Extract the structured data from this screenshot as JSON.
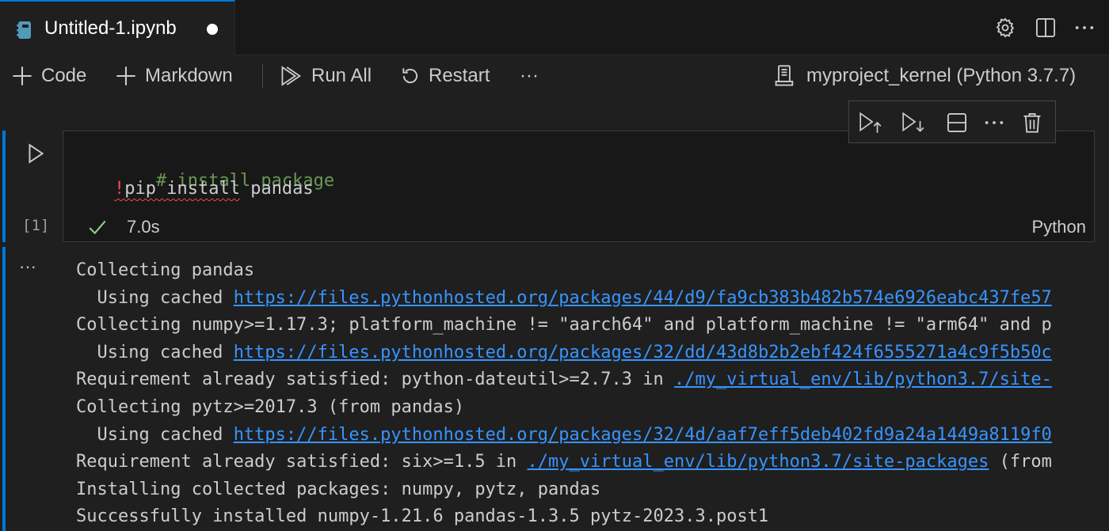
{
  "tab": {
    "title": "Untitled-1.ipynb",
    "icon": "notebook-icon",
    "modified": true
  },
  "tab_actions": [
    "gear-icon",
    "split-editor-icon",
    "more-icon"
  ],
  "toolbar": {
    "code_label": "Code",
    "markdown_label": "Markdown",
    "run_all_label": "Run All",
    "restart_label": "Restart",
    "more_label": "···",
    "kernel_label": "myproject_kernel (Python 3.7.7)"
  },
  "cell_toolbar": [
    "execute-above-icon",
    "execute-below-icon",
    "split-cell-icon",
    "more-icon",
    "trash-icon"
  ],
  "cell": {
    "execution_count": "[1]",
    "code_comment": "# install package",
    "code_bang": "!",
    "code_pip": "pip install",
    "code_rest": " pandas",
    "status_time": "7.0s",
    "language": "Python"
  },
  "output": {
    "more_label": "···",
    "lines": [
      {
        "text": "Collecting pandas"
      },
      {
        "text": "  Using cached ",
        "link": "https://files.pythonhosted.org/packages/44/d9/fa9cb383b482b574e6926eabc437fe57"
      },
      {
        "text": "Collecting numpy>=1.17.3; platform_machine != \"aarch64\" and platform_machine != \"arm64\" and p"
      },
      {
        "text": "  Using cached ",
        "link": "https://files.pythonhosted.org/packages/32/dd/43d8b2b2ebf424f6555271a4c9f5b50c"
      },
      {
        "text": "Requirement already satisfied: python-dateutil>=2.7.3 in ",
        "link": "./my_virtual_env/lib/python3.7/site-"
      },
      {
        "text": "Collecting pytz>=2017.3 (from pandas)"
      },
      {
        "text": "  Using cached ",
        "link": "https://files.pythonhosted.org/packages/32/4d/aaf7eff5deb402fd9a24a1449a8119f0"
      },
      {
        "text": "Requirement already satisfied: six>=1.5 in ",
        "link": "./my_virtual_env/lib/python3.7/site-packages",
        "suffix": " (from"
      },
      {
        "text": "Installing collected packages: numpy, pytz, pandas"
      },
      {
        "text": "Successfully installed numpy-1.21.6 pandas-1.3.5 pytz-2023.3.post1"
      }
    ]
  },
  "colors": {
    "accent": "#0078d4",
    "comment": "#6a9955",
    "link": "#3794ff",
    "error": "#f14c4c",
    "success": "#89d185"
  }
}
